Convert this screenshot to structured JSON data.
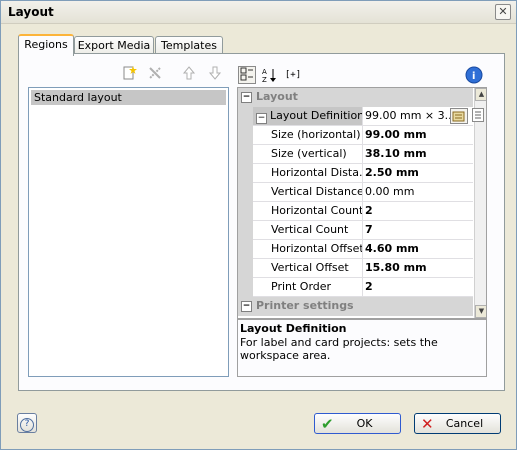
{
  "window": {
    "title": "Layout",
    "close_glyph": "✕"
  },
  "tabs": [
    {
      "label": "Regions",
      "active": true
    },
    {
      "label": "Export Media",
      "active": false
    },
    {
      "label": "Templates",
      "active": false
    }
  ],
  "left_toolbar": {
    "icons": [
      "new-layout-icon",
      "delete-layout-icon",
      "move-up-icon",
      "move-down-icon"
    ]
  },
  "layout_list": {
    "items": [
      "Standard layout"
    ]
  },
  "grid_toolbar": {
    "categorized_icon": "categorized-icon",
    "alphabetical_icon": "sort-alphabetical-icon",
    "expand_label": "[+]",
    "info_icon": "info-icon"
  },
  "property_grid": {
    "layout_category": "Layout",
    "layout_definition": {
      "name": "Layout Definition",
      "value": "99.00 mm × 3..."
    },
    "properties": [
      {
        "name": "Size (horizontal)",
        "value": "99.00 mm",
        "bold": true
      },
      {
        "name": "Size (vertical)",
        "value": "38.10 mm",
        "bold": true
      },
      {
        "name": "Horizontal Dista...",
        "value": "2.50 mm",
        "bold": true
      },
      {
        "name": "Vertical Distance",
        "value": "0.00 mm",
        "bold": false
      },
      {
        "name": "Horizontal Count",
        "value": "2",
        "bold": true
      },
      {
        "name": "Vertical Count",
        "value": "7",
        "bold": true
      },
      {
        "name": "Horizontal Offset",
        "value": "4.60 mm",
        "bold": true
      },
      {
        "name": "Vertical Offset",
        "value": "15.80 mm",
        "bold": true
      },
      {
        "name": "Print Order",
        "value": "2",
        "bold": true
      }
    ],
    "printer_category": "Printer settings"
  },
  "description": {
    "title": "Layout Definition",
    "text": "For label and card projects: sets the workspace area."
  },
  "footer": {
    "help_glyph": "?",
    "ok_label": "OK",
    "cancel_label": "Cancel"
  },
  "colors": {
    "selection": "#c6c6c6",
    "tab_accent": "#fcb43a",
    "ok_check": "#2e9e2e",
    "cancel_x": "#d02020"
  }
}
